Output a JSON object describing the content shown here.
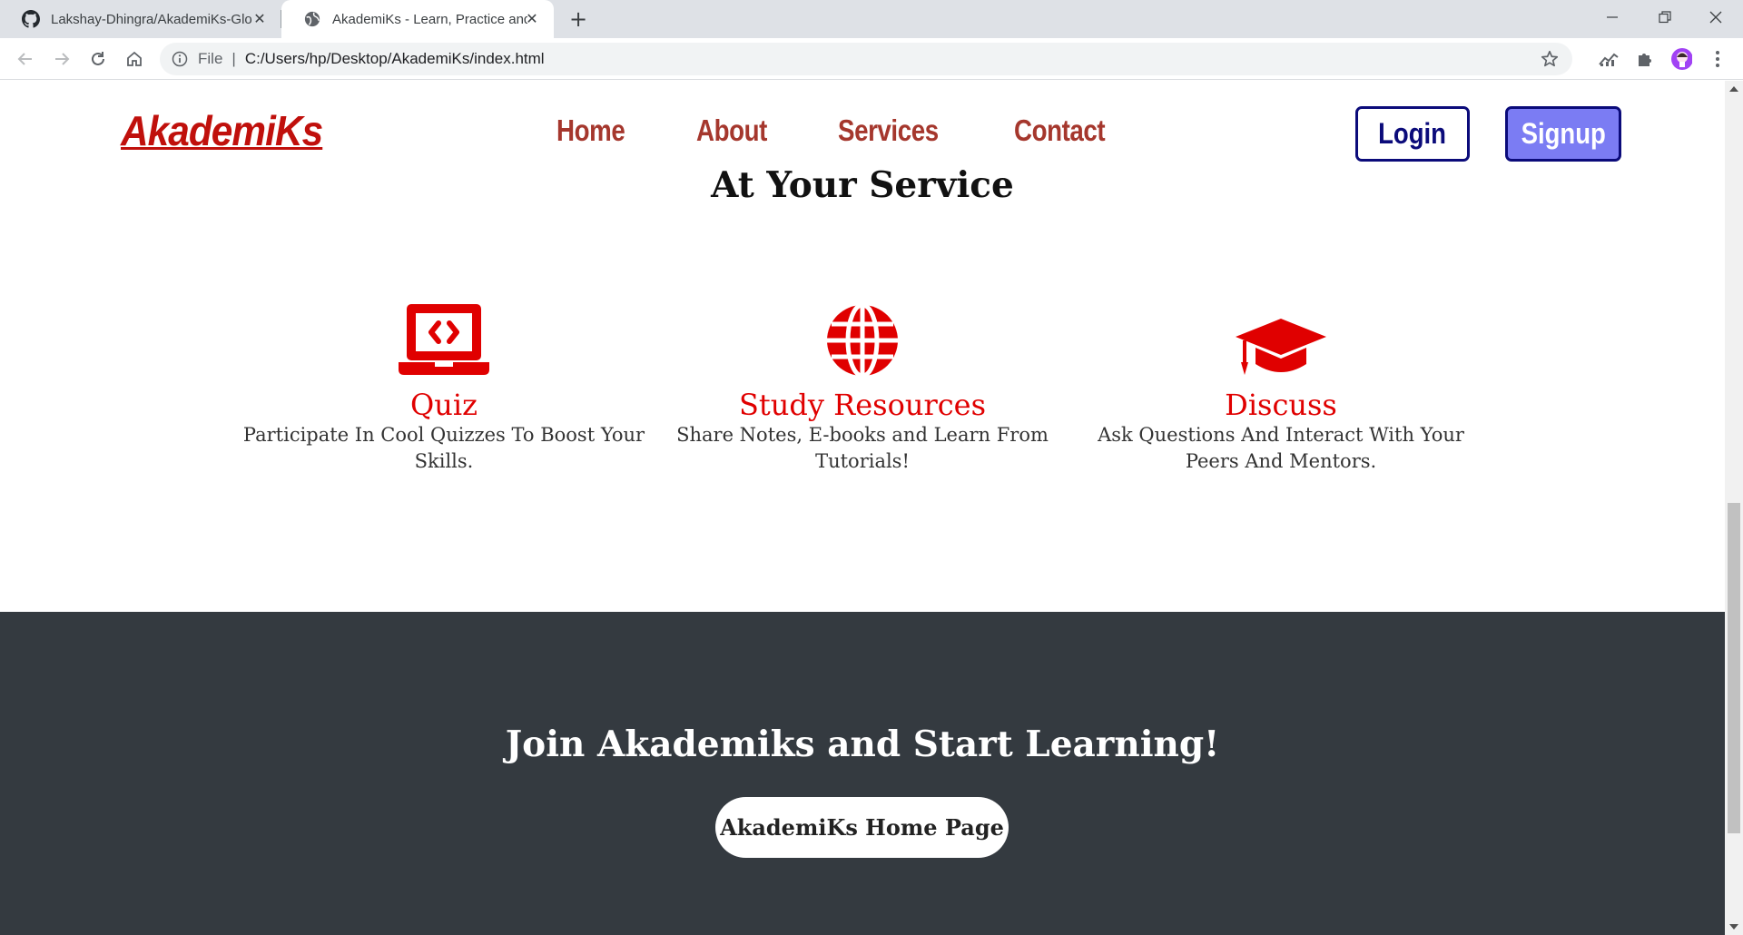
{
  "browser": {
    "tabs": [
      {
        "title": "Lakshay-Dhingra/AkademiKs-Glo",
        "active": false
      },
      {
        "title": "AkademiKs - Learn, Practice and ",
        "active": true
      }
    ],
    "address": {
      "scheme": "File",
      "path": "C:/Users/hp/Desktop/AkademiKs/index.html"
    }
  },
  "header": {
    "logo": "AkademiKs",
    "nav": [
      "Home",
      "About",
      "Services",
      "Contact"
    ],
    "login_label": "Login",
    "signup_label": "Signup"
  },
  "services": {
    "heading": "At Your Service",
    "items": [
      {
        "icon": "laptop-code-icon",
        "title": "Quiz",
        "desc_line1": "Participate In Cool Quizzes To Boost Your",
        "desc_line2": "Skills."
      },
      {
        "icon": "globe-icon",
        "title": "Study Resources",
        "desc_line1": "Share Notes, E-books and Learn From",
        "desc_line2": "Tutorials!"
      },
      {
        "icon": "graduation-cap-icon",
        "title": "Discuss",
        "desc_line1": "Ask Questions And Interact With Your",
        "desc_line2": "Peers And Mentors."
      }
    ]
  },
  "footer": {
    "title": "Join Akademiks and Start Learning!",
    "button_label": "AkademiKs Home Page"
  },
  "colors": {
    "brand_red": "#c0100c",
    "icon_red": "#e00000",
    "nav_brown": "#a5372d",
    "login_border": "#0b0b7a",
    "signup_bg": "#7b7cf3",
    "footer_bg": "#343a40"
  }
}
